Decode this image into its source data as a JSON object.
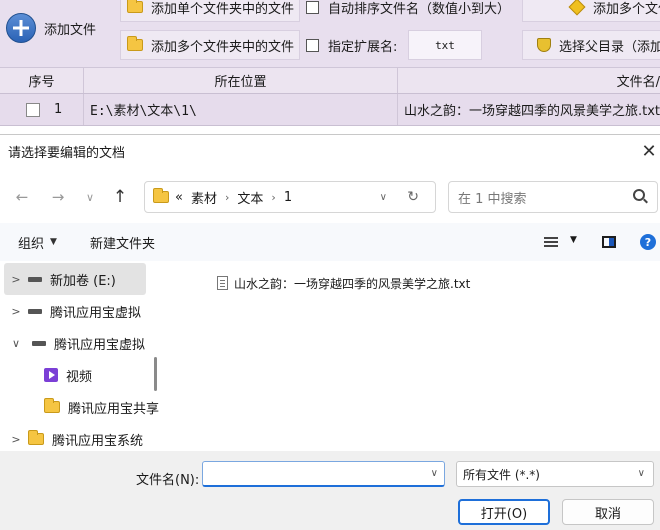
{
  "app": {
    "add_file_label": "添加文件",
    "toolbar": {
      "add_single_folder_label": "添加单个文件夹中的文件",
      "auto_sort_label": "自动排序文件名（数值小到大）",
      "add_multi_top_label": "添加多个文件",
      "add_multi_folder_label": "添加多个文件夹中的文件",
      "ext_label": "指定扩展名:",
      "ext_value": "txt",
      "select_parent_label": "选择父目录（添加"
    },
    "table": {
      "headers": {
        "index": "序号",
        "location": "所在位置",
        "filename": "文件名/"
      },
      "rows": [
        {
          "index": "1",
          "location": "E:\\素材\\文本\\1\\",
          "filename": "山水之韵：一场穿越四季的风景美学之旅.txt"
        }
      ]
    }
  },
  "dialog": {
    "title": "请选择要编辑的文档",
    "nav": {
      "back": "←",
      "forward": "→",
      "recent": "∨",
      "up": "↑"
    },
    "address": {
      "overflow": "«",
      "crumbs": [
        "素材",
        "文本",
        "1"
      ]
    },
    "search_placeholder": "在 1 中搜索",
    "commands": {
      "organize_label": "组织",
      "new_folder_label": "新建文件夹",
      "help_label": "?"
    },
    "tree": [
      {
        "label": "新加卷 (E:)",
        "icon": "drive-icon",
        "arrow": ">",
        "selected": true
      },
      {
        "label": "腾讯应用宝虚拟",
        "icon": "drive-icon",
        "arrow": ">"
      },
      {
        "label": "腾讯应用宝虚拟",
        "icon": "drive-icon",
        "arrow": "∨"
      },
      {
        "label": "视频",
        "icon": "video-icon",
        "arrow": ""
      },
      {
        "label": "腾讯应用宝共享",
        "icon": "folder-icon",
        "arrow": ""
      },
      {
        "label": "腾讯应用宝系统",
        "icon": "folder-icon",
        "arrow": ">"
      }
    ],
    "files": [
      {
        "name": "山水之韵：一场穿越四季的风景美学之旅.txt",
        "icon": "txt-file-icon"
      }
    ],
    "footer": {
      "filename_label": "文件名(N):",
      "filename_value": "",
      "filetype_value": "所有文件 (*.*)",
      "open_label": "打开(O)",
      "cancel_label": "取消"
    }
  }
}
